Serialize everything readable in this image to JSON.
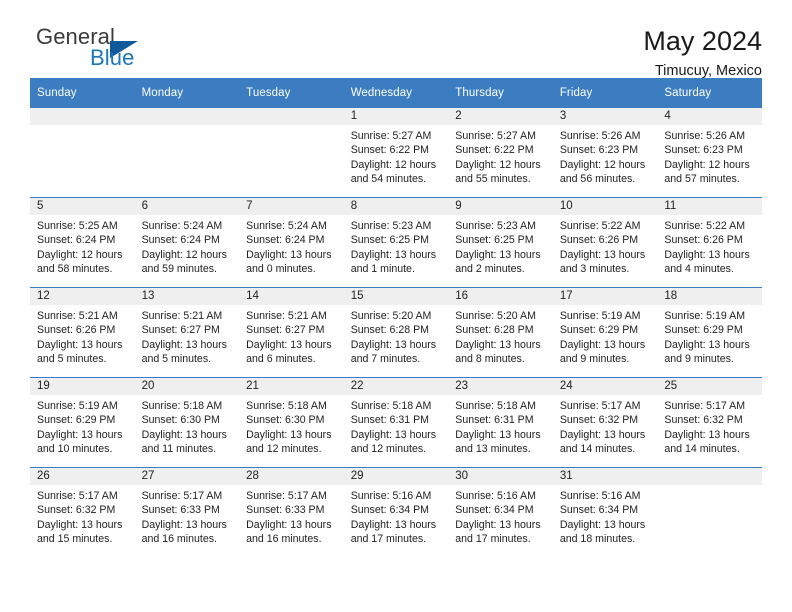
{
  "brand": {
    "name_part1": "General",
    "name_part2": "Blue",
    "triangle_icon": "triangle-icon"
  },
  "header": {
    "title": "May 2024",
    "location": "Timucuy, Mexico"
  },
  "colors": {
    "header_blue": "#3b7dc0",
    "brand_blue": "#1b76bc",
    "daynum_strip": "#efefef",
    "text": "#1f1f1f"
  },
  "weekday_headers": [
    "Sunday",
    "Monday",
    "Tuesday",
    "Wednesday",
    "Thursday",
    "Friday",
    "Saturday"
  ],
  "weeks": [
    [
      {
        "day": "",
        "empty": true,
        "sunrise": "",
        "sunset": "",
        "daylight1": "",
        "daylight2": ""
      },
      {
        "day": "",
        "empty": true,
        "sunrise": "",
        "sunset": "",
        "daylight1": "",
        "daylight2": ""
      },
      {
        "day": "",
        "empty": true,
        "sunrise": "",
        "sunset": "",
        "daylight1": "",
        "daylight2": ""
      },
      {
        "day": "1",
        "empty": false,
        "sunrise": "Sunrise: 5:27 AM",
        "sunset": "Sunset: 6:22 PM",
        "daylight1": "Daylight: 12 hours",
        "daylight2": "and 54 minutes."
      },
      {
        "day": "2",
        "empty": false,
        "sunrise": "Sunrise: 5:27 AM",
        "sunset": "Sunset: 6:22 PM",
        "daylight1": "Daylight: 12 hours",
        "daylight2": "and 55 minutes."
      },
      {
        "day": "3",
        "empty": false,
        "sunrise": "Sunrise: 5:26 AM",
        "sunset": "Sunset: 6:23 PM",
        "daylight1": "Daylight: 12 hours",
        "daylight2": "and 56 minutes."
      },
      {
        "day": "4",
        "empty": false,
        "sunrise": "Sunrise: 5:26 AM",
        "sunset": "Sunset: 6:23 PM",
        "daylight1": "Daylight: 12 hours",
        "daylight2": "and 57 minutes."
      }
    ],
    [
      {
        "day": "5",
        "empty": false,
        "sunrise": "Sunrise: 5:25 AM",
        "sunset": "Sunset: 6:24 PM",
        "daylight1": "Daylight: 12 hours",
        "daylight2": "and 58 minutes."
      },
      {
        "day": "6",
        "empty": false,
        "sunrise": "Sunrise: 5:24 AM",
        "sunset": "Sunset: 6:24 PM",
        "daylight1": "Daylight: 12 hours",
        "daylight2": "and 59 minutes."
      },
      {
        "day": "7",
        "empty": false,
        "sunrise": "Sunrise: 5:24 AM",
        "sunset": "Sunset: 6:24 PM",
        "daylight1": "Daylight: 13 hours",
        "daylight2": "and 0 minutes."
      },
      {
        "day": "8",
        "empty": false,
        "sunrise": "Sunrise: 5:23 AM",
        "sunset": "Sunset: 6:25 PM",
        "daylight1": "Daylight: 13 hours",
        "daylight2": "and 1 minute."
      },
      {
        "day": "9",
        "empty": false,
        "sunrise": "Sunrise: 5:23 AM",
        "sunset": "Sunset: 6:25 PM",
        "daylight1": "Daylight: 13 hours",
        "daylight2": "and 2 minutes."
      },
      {
        "day": "10",
        "empty": false,
        "sunrise": "Sunrise: 5:22 AM",
        "sunset": "Sunset: 6:26 PM",
        "daylight1": "Daylight: 13 hours",
        "daylight2": "and 3 minutes."
      },
      {
        "day": "11",
        "empty": false,
        "sunrise": "Sunrise: 5:22 AM",
        "sunset": "Sunset: 6:26 PM",
        "daylight1": "Daylight: 13 hours",
        "daylight2": "and 4 minutes."
      }
    ],
    [
      {
        "day": "12",
        "empty": false,
        "sunrise": "Sunrise: 5:21 AM",
        "sunset": "Sunset: 6:26 PM",
        "daylight1": "Daylight: 13 hours",
        "daylight2": "and 5 minutes."
      },
      {
        "day": "13",
        "empty": false,
        "sunrise": "Sunrise: 5:21 AM",
        "sunset": "Sunset: 6:27 PM",
        "daylight1": "Daylight: 13 hours",
        "daylight2": "and 5 minutes."
      },
      {
        "day": "14",
        "empty": false,
        "sunrise": "Sunrise: 5:21 AM",
        "sunset": "Sunset: 6:27 PM",
        "daylight1": "Daylight: 13 hours",
        "daylight2": "and 6 minutes."
      },
      {
        "day": "15",
        "empty": false,
        "sunrise": "Sunrise: 5:20 AM",
        "sunset": "Sunset: 6:28 PM",
        "daylight1": "Daylight: 13 hours",
        "daylight2": "and 7 minutes."
      },
      {
        "day": "16",
        "empty": false,
        "sunrise": "Sunrise: 5:20 AM",
        "sunset": "Sunset: 6:28 PM",
        "daylight1": "Daylight: 13 hours",
        "daylight2": "and 8 minutes."
      },
      {
        "day": "17",
        "empty": false,
        "sunrise": "Sunrise: 5:19 AM",
        "sunset": "Sunset: 6:29 PM",
        "daylight1": "Daylight: 13 hours",
        "daylight2": "and 9 minutes."
      },
      {
        "day": "18",
        "empty": false,
        "sunrise": "Sunrise: 5:19 AM",
        "sunset": "Sunset: 6:29 PM",
        "daylight1": "Daylight: 13 hours",
        "daylight2": "and 9 minutes."
      }
    ],
    [
      {
        "day": "19",
        "empty": false,
        "sunrise": "Sunrise: 5:19 AM",
        "sunset": "Sunset: 6:29 PM",
        "daylight1": "Daylight: 13 hours",
        "daylight2": "and 10 minutes."
      },
      {
        "day": "20",
        "empty": false,
        "sunrise": "Sunrise: 5:18 AM",
        "sunset": "Sunset: 6:30 PM",
        "daylight1": "Daylight: 13 hours",
        "daylight2": "and 11 minutes."
      },
      {
        "day": "21",
        "empty": false,
        "sunrise": "Sunrise: 5:18 AM",
        "sunset": "Sunset: 6:30 PM",
        "daylight1": "Daylight: 13 hours",
        "daylight2": "and 12 minutes."
      },
      {
        "day": "22",
        "empty": false,
        "sunrise": "Sunrise: 5:18 AM",
        "sunset": "Sunset: 6:31 PM",
        "daylight1": "Daylight: 13 hours",
        "daylight2": "and 12 minutes."
      },
      {
        "day": "23",
        "empty": false,
        "sunrise": "Sunrise: 5:18 AM",
        "sunset": "Sunset: 6:31 PM",
        "daylight1": "Daylight: 13 hours",
        "daylight2": "and 13 minutes."
      },
      {
        "day": "24",
        "empty": false,
        "sunrise": "Sunrise: 5:17 AM",
        "sunset": "Sunset: 6:32 PM",
        "daylight1": "Daylight: 13 hours",
        "daylight2": "and 14 minutes."
      },
      {
        "day": "25",
        "empty": false,
        "sunrise": "Sunrise: 5:17 AM",
        "sunset": "Sunset: 6:32 PM",
        "daylight1": "Daylight: 13 hours",
        "daylight2": "and 14 minutes."
      }
    ],
    [
      {
        "day": "26",
        "empty": false,
        "sunrise": "Sunrise: 5:17 AM",
        "sunset": "Sunset: 6:32 PM",
        "daylight1": "Daylight: 13 hours",
        "daylight2": "and 15 minutes."
      },
      {
        "day": "27",
        "empty": false,
        "sunrise": "Sunrise: 5:17 AM",
        "sunset": "Sunset: 6:33 PM",
        "daylight1": "Daylight: 13 hours",
        "daylight2": "and 16 minutes."
      },
      {
        "day": "28",
        "empty": false,
        "sunrise": "Sunrise: 5:17 AM",
        "sunset": "Sunset: 6:33 PM",
        "daylight1": "Daylight: 13 hours",
        "daylight2": "and 16 minutes."
      },
      {
        "day": "29",
        "empty": false,
        "sunrise": "Sunrise: 5:16 AM",
        "sunset": "Sunset: 6:34 PM",
        "daylight1": "Daylight: 13 hours",
        "daylight2": "and 17 minutes."
      },
      {
        "day": "30",
        "empty": false,
        "sunrise": "Sunrise: 5:16 AM",
        "sunset": "Sunset: 6:34 PM",
        "daylight1": "Daylight: 13 hours",
        "daylight2": "and 17 minutes."
      },
      {
        "day": "31",
        "empty": false,
        "sunrise": "Sunrise: 5:16 AM",
        "sunset": "Sunset: 6:34 PM",
        "daylight1": "Daylight: 13 hours",
        "daylight2": "and 18 minutes."
      },
      {
        "day": "",
        "empty": true,
        "sunrise": "",
        "sunset": "",
        "daylight1": "",
        "daylight2": ""
      }
    ]
  ]
}
